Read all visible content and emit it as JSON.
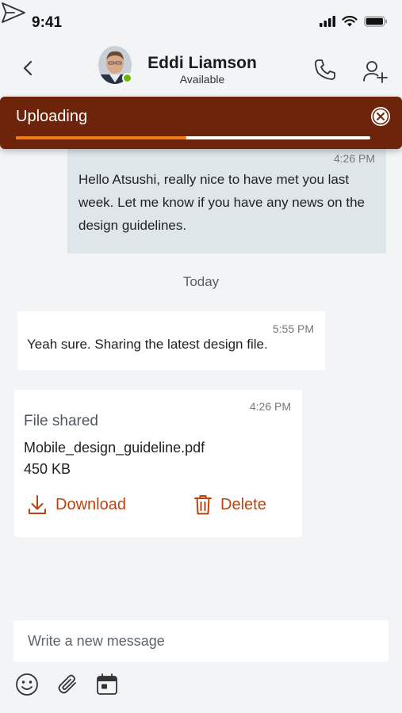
{
  "status_bar": {
    "time": "9:41"
  },
  "header": {
    "contact_name": "Eddi Liamson",
    "contact_status": "Available"
  },
  "upload": {
    "label": "Uploading",
    "progress_percent": 48,
    "accent_color": "#f07c16",
    "banner_color": "#6e240a"
  },
  "messages": [
    {
      "time": "4:26 PM",
      "text": "Hello Atsushi, really nice to have met you last week. Let me know if you have any news on the design guidelines."
    },
    {
      "time": "5:55 PM",
      "text": "Yeah sure. Sharing the latest design file."
    }
  ],
  "date_divider": "Today",
  "file_message": {
    "time": "4:26 PM",
    "title": "File shared",
    "file_name": "Mobile_design_guideline.pdf",
    "file_size": "450 KB",
    "download_label": "Download",
    "delete_label": "Delete",
    "action_color": "#b84310"
  },
  "composer": {
    "placeholder": "Write a new message"
  },
  "icons": {
    "back": "chevron-left-icon",
    "call": "phone-icon",
    "add_user": "person-add-icon",
    "close": "close-circle-icon",
    "download": "download-icon",
    "delete": "trash-icon",
    "emoji": "emoji-icon",
    "attach": "paperclip-icon",
    "calendar": "calendar-icon",
    "send": "send-icon"
  }
}
